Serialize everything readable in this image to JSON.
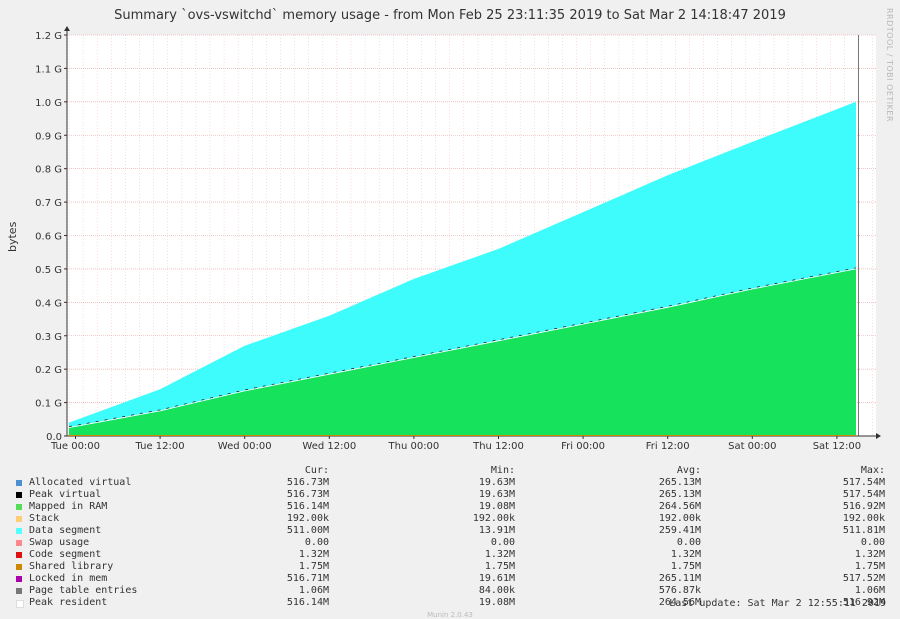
{
  "chart_data": {
    "type": "area",
    "title": "Summary `ovs-vswitchd` memory usage - from Mon Feb 25 23:11:35 2019 to Sat Mar  2 14:18:47 2019",
    "ylabel": "bytes",
    "xlabel": "",
    "ylim": [
      0,
      1.2
    ],
    "y_unit": "G",
    "y_ticks": [
      "0.0",
      "0.1 G",
      "0.2 G",
      "0.3 G",
      "0.4 G",
      "0.5 G",
      "0.6 G",
      "0.7 G",
      "0.8 G",
      "0.9 G",
      "1.0 G",
      "1.1 G",
      "1.2 G"
    ],
    "x_ticks": [
      "Tue 00:00",
      "Tue 12:00",
      "Wed 00:00",
      "Wed 12:00",
      "Thu 00:00",
      "Thu 12:00",
      "Fri 00:00",
      "Fri 12:00",
      "Sat 00:00",
      "Sat 12:00"
    ],
    "grid": true,
    "series": [
      {
        "name": "Mapped in RAM",
        "color": "#16e25c",
        "x": [
          "Tue 00:00",
          "Tue 12:00",
          "Wed 00:00",
          "Wed 12:00",
          "Thu 00:00",
          "Thu 12:00",
          "Fri 00:00",
          "Fri 12:00",
          "Sat 00:00",
          "Sat 12:00"
        ],
        "values": [
          0.025,
          0.075,
          0.135,
          0.185,
          0.235,
          0.285,
          0.335,
          0.385,
          0.44,
          0.5
        ]
      },
      {
        "name": "Data segment",
        "color": "#3ffcfc",
        "x": [
          "Tue 00:00",
          "Tue 12:00",
          "Wed 00:00",
          "Wed 12:00",
          "Thu 00:00",
          "Thu 12:00",
          "Fri 00:00",
          "Fri 12:00",
          "Sat 00:00",
          "Sat 12:00"
        ],
        "values": [
          0.04,
          0.14,
          0.27,
          0.36,
          0.47,
          0.56,
          0.67,
          0.78,
          0.88,
          1.0
        ]
      }
    ]
  },
  "legend": {
    "headers": {
      "cur": "Cur:",
      "min": "Min:",
      "avg": "Avg:",
      "max": "Max:"
    },
    "rows": [
      {
        "color": "#4d8fd1",
        "name": "Allocated virtual",
        "cur": "516.73M",
        "min": "19.63M",
        "avg": "265.13M",
        "max": "517.54M"
      },
      {
        "color": "#000000",
        "name": "Peak virtual",
        "cur": "516.73M",
        "min": "19.63M",
        "avg": "265.13M",
        "max": "517.54M"
      },
      {
        "color": "#55dd55",
        "name": "Mapped in RAM",
        "cur": "516.14M",
        "min": "19.08M",
        "avg": "264.56M",
        "max": "516.92M"
      },
      {
        "color": "#ffcc77",
        "name": "Stack",
        "cur": "192.00k",
        "min": "192.00k",
        "avg": "192.00k",
        "max": "192.00k"
      },
      {
        "color": "#55ffff",
        "name": "Data segment",
        "cur": "511.00M",
        "min": "13.91M",
        "avg": "259.41M",
        "max": "511.81M"
      },
      {
        "color": "#ff8888",
        "name": "Swap usage",
        "cur": "0.00",
        "min": "0.00",
        "avg": "0.00",
        "max": "0.00"
      },
      {
        "color": "#dd1111",
        "name": "Code segment",
        "cur": "1.32M",
        "min": "1.32M",
        "avg": "1.32M",
        "max": "1.32M"
      },
      {
        "color": "#cc8800",
        "name": "Shared library",
        "cur": "1.75M",
        "min": "1.75M",
        "avg": "1.75M",
        "max": "1.75M"
      },
      {
        "color": "#aa00aa",
        "name": "Locked in mem",
        "cur": "516.71M",
        "min": "19.61M",
        "avg": "265.11M",
        "max": "517.52M"
      },
      {
        "color": "#777777",
        "name": "Page table entries",
        "cur": "1.06M",
        "min": "84.00k",
        "avg": "576.87k",
        "max": "1.06M"
      },
      {
        "color": "#ffffff",
        "name": "Peak resident",
        "cur": "516.14M",
        "min": "19.08M",
        "avg": "264.56M",
        "max": "516.92M"
      }
    ]
  },
  "last_update": "Last update: Sat Mar  2 12:55:11 2019",
  "watermark": "RRDTOOL / TOBI OETIKER",
  "footer": "Munin 2.0.43"
}
